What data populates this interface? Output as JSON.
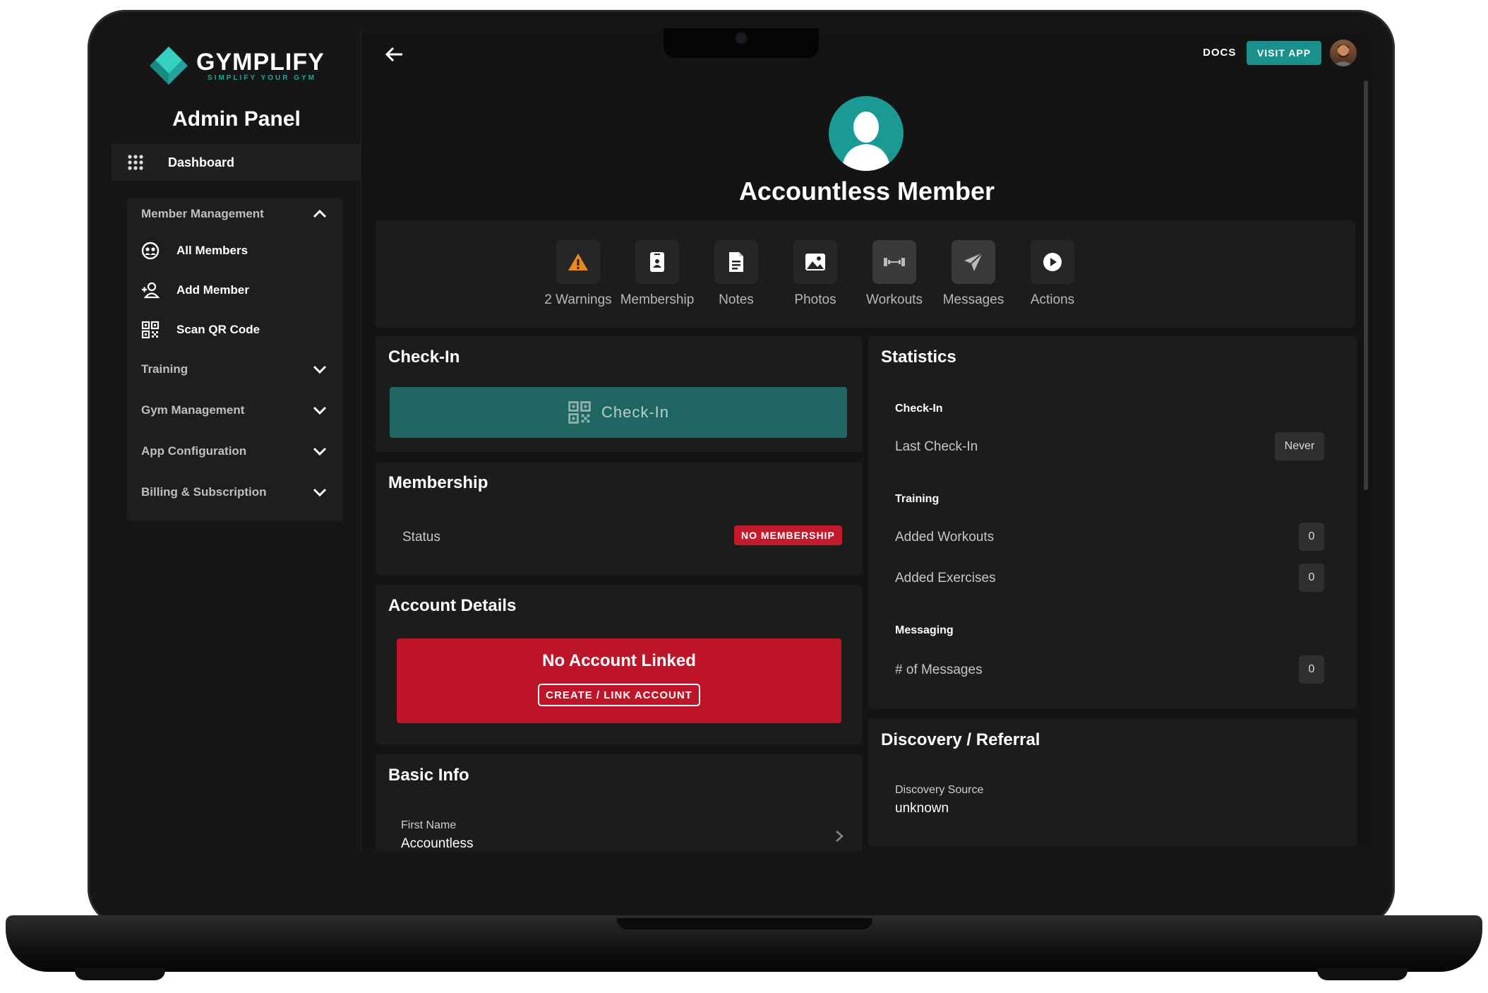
{
  "sidebar": {
    "brand": "GYMPLIFY",
    "tagline": "SIMPLIFY YOUR GYM",
    "title": "Admin Panel",
    "dashboard": "Dashboard",
    "sections": [
      {
        "label": "Member Management",
        "expanded": true
      },
      {
        "label": "Training",
        "expanded": false
      },
      {
        "label": "Gym Management",
        "expanded": false
      },
      {
        "label": "App Configuration",
        "expanded": false
      },
      {
        "label": "Billing & Subscription",
        "expanded": false
      }
    ],
    "member_items": [
      "All Members",
      "Add Member",
      "Scan QR Code"
    ]
  },
  "topbar": {
    "docs": "DOCS",
    "visit_app": "VISIT APP"
  },
  "member": {
    "name": "Accountless Member"
  },
  "tabs": [
    {
      "label": "2 Warnings",
      "icon": "warning-icon"
    },
    {
      "label": "Membership",
      "icon": "membership-card-icon"
    },
    {
      "label": "Notes",
      "icon": "notes-icon"
    },
    {
      "label": "Photos",
      "icon": "photos-icon"
    },
    {
      "label": "Workouts",
      "icon": "dumbbell-icon"
    },
    {
      "label": "Messages",
      "icon": "send-icon"
    },
    {
      "label": "Actions",
      "icon": "play-icon"
    }
  ],
  "checkin": {
    "title": "Check-In",
    "button": "Check-In"
  },
  "membership": {
    "title": "Membership",
    "status_label": "Status",
    "status_value": "NO MEMBERSHIP"
  },
  "account": {
    "title": "Account Details",
    "message": "No Account Linked",
    "button": "CREATE / LINK ACCOUNT"
  },
  "basic_info": {
    "title": "Basic Info",
    "first_name_label": "First Name",
    "first_name_value": "Accountless"
  },
  "statistics": {
    "title": "Statistics",
    "checkin_heading": "Check-In",
    "last_checkin_label": "Last Check-In",
    "last_checkin_value": "Never",
    "training_heading": "Training",
    "added_workouts_label": "Added Workouts",
    "added_workouts_value": "0",
    "added_exercises_label": "Added Exercises",
    "added_exercises_value": "0",
    "messaging_heading": "Messaging",
    "messages_label": "# of Messages",
    "messages_value": "0"
  },
  "discovery": {
    "title": "Discovery / Referral",
    "source_label": "Discovery Source",
    "source_value": "unknown"
  },
  "colors": {
    "accent": "#1a8f8c",
    "danger": "#c41a2e",
    "warning": "#e8891a",
    "background": "#141414",
    "card": "#1c1c1c"
  }
}
